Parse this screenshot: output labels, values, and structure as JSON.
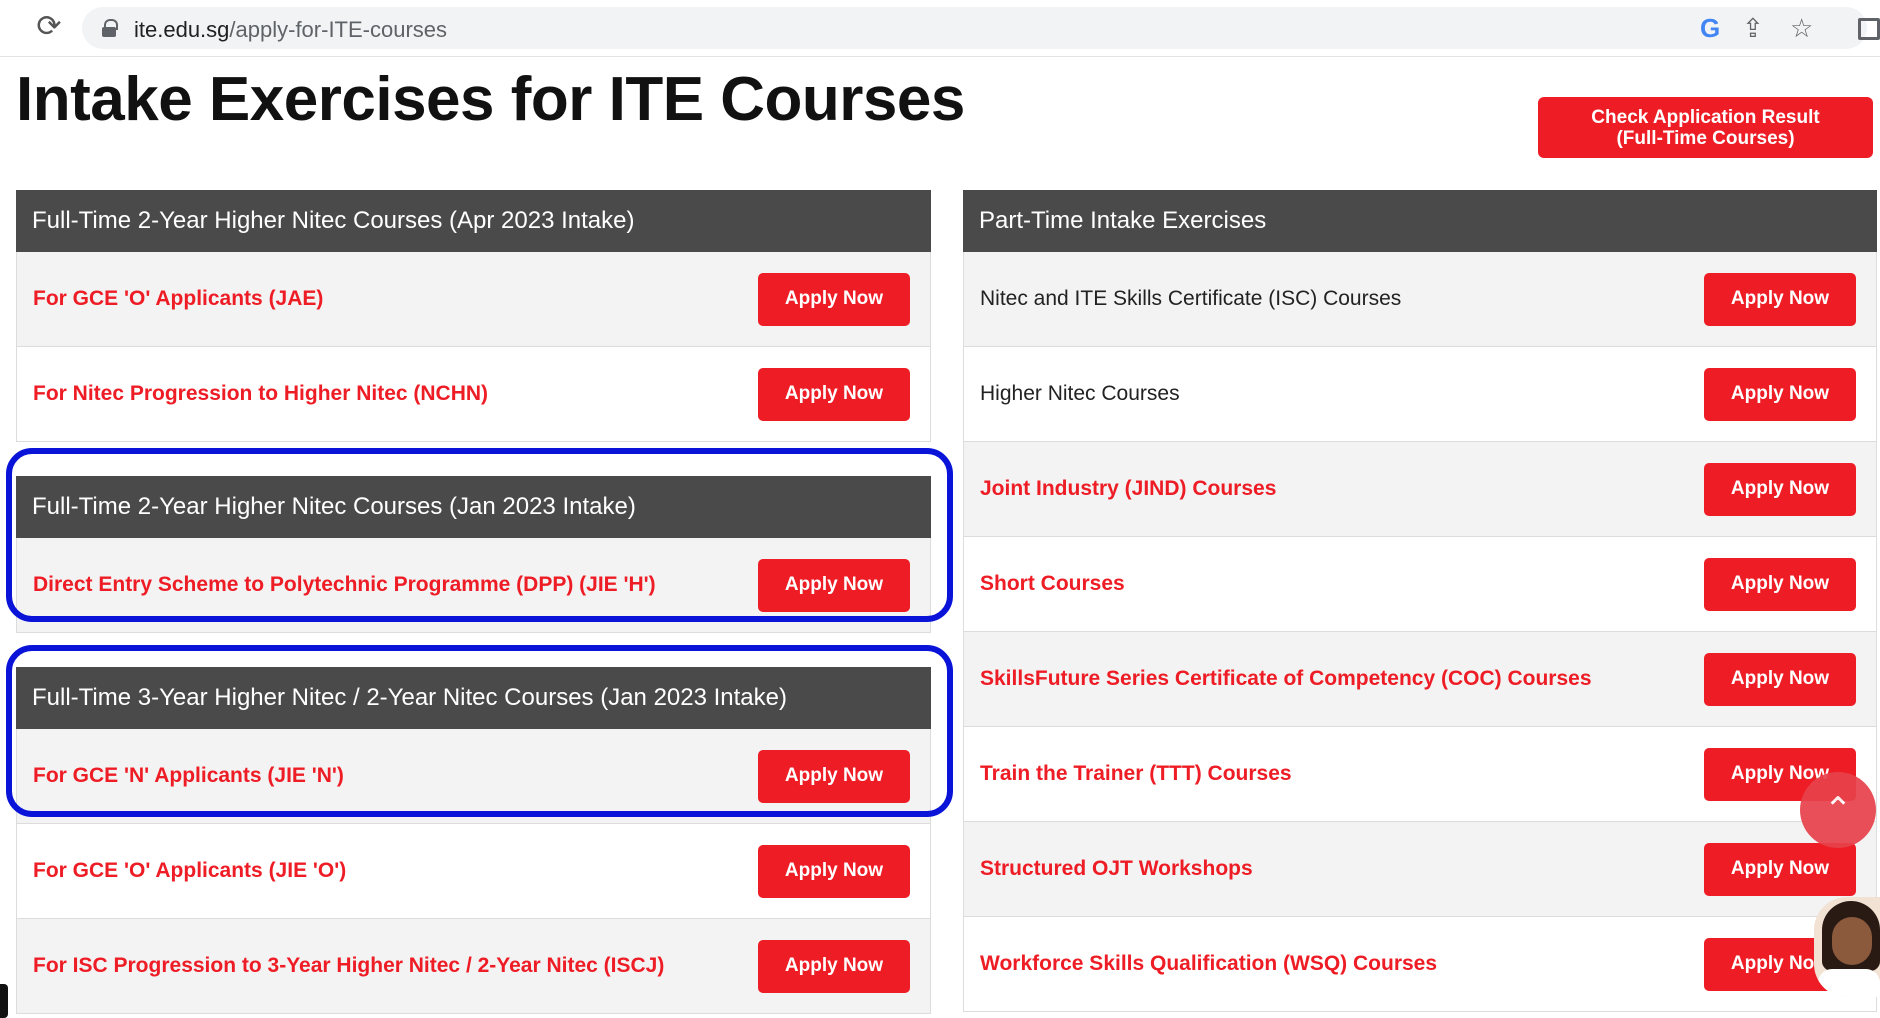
{
  "browser": {
    "reload_icon": "⟳",
    "url_host": "ite.edu.sg",
    "url_path": "/apply-for-ITE-courses",
    "icons": [
      "google-icon",
      "share-icon",
      "star-icon",
      "side-panel-icon"
    ]
  },
  "page": {
    "title": "Intake Exercises for ITE Courses",
    "check_result": {
      "line1": "Check Application Result",
      "line2": "(Full-Time Courses)"
    }
  },
  "apply_label": "Apply Now",
  "left_panels": [
    {
      "header": "Full-Time 2-Year Higher Nitec Courses (Apr 2023 Intake)",
      "rows": [
        "For GCE 'O' Applicants (JAE)",
        "For Nitec Progression to Higher Nitec (NCHN)"
      ]
    },
    {
      "header": "Full-Time 2-Year Higher Nitec Courses (Jan 2023 Intake)",
      "rows": [
        "Direct Entry Scheme to Polytechnic Programme (DPP) (JIE 'H')"
      ]
    },
    {
      "header": "Full-Time 3-Year Higher Nitec / 2-Year Nitec Courses (Jan 2023 Intake)",
      "rows": [
        "For GCE 'N' Applicants (JIE 'N')",
        "For GCE 'O' Applicants (JIE 'O')",
        "For ISC Progression to 3-Year Higher Nitec / 2-Year Nitec (ISCJ)"
      ]
    }
  ],
  "right_panel": {
    "header": "Part-Time Intake Exercises",
    "rows": [
      "Nitec and ITE Skills Certificate (ISC) Courses",
      "Higher Nitec Courses",
      "Joint Industry (JIND) Courses",
      "Short Courses",
      "SkillsFuture Series Certificate of Competency (COC) Courses",
      "Train the Trainer (TTT) Courses",
      "Structured OJT Workshops",
      "Workforce Skills Qualification (WSQ) Courses"
    ]
  },
  "colors": {
    "accent_red": "#ee1c25",
    "header_grey": "#4a4a4a",
    "highlight_blue": "#0a14d8"
  }
}
